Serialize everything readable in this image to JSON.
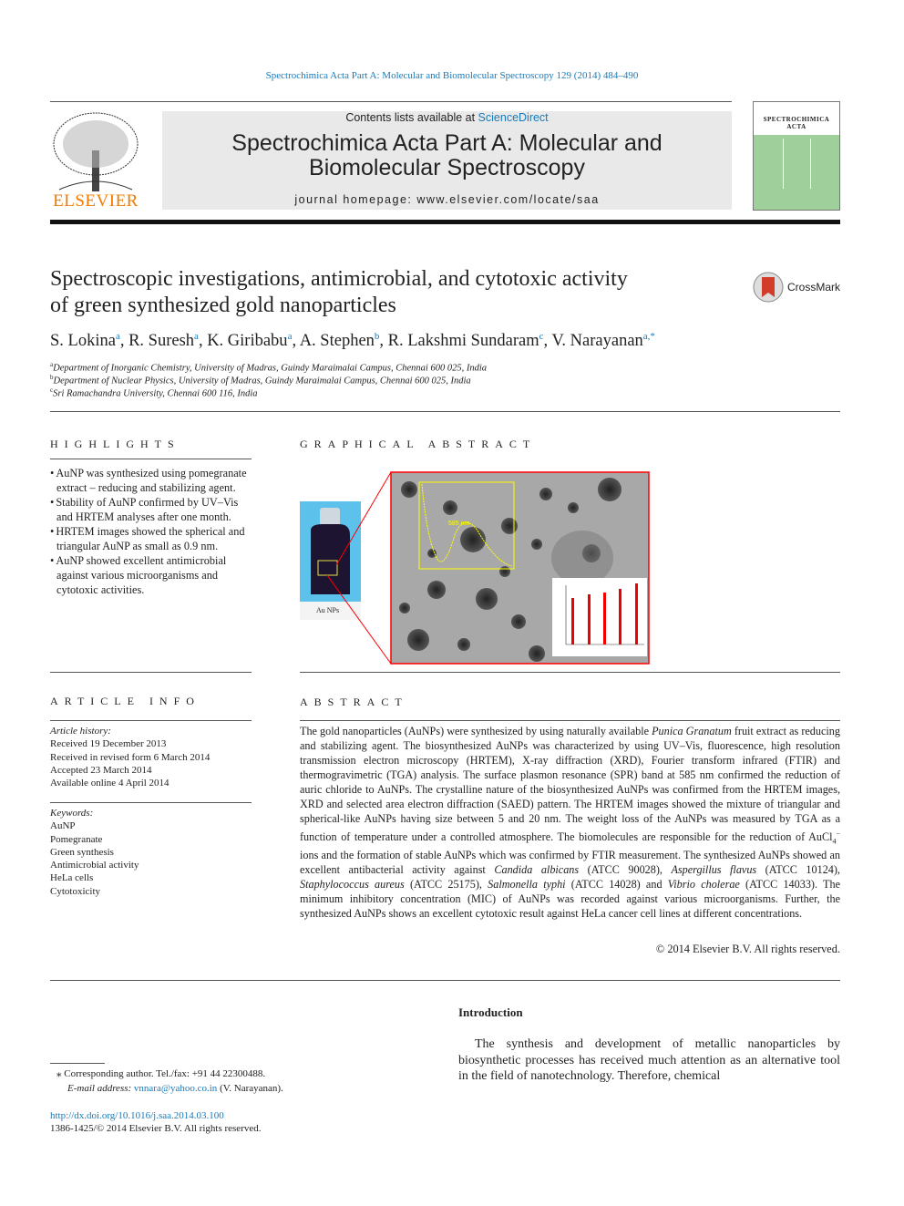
{
  "header": {
    "citation": "Spectrochimica Acta Part A: Molecular and Biomolecular Spectroscopy 129 (2014) 484–490",
    "contents_prefix": "Contents lists available at ",
    "contents_link": "ScienceDirect",
    "journal_title_1": "Spectrochimica Acta Part A: Molecular and",
    "journal_title_2": "Biomolecular Spectroscopy",
    "homepage": "journal homepage: www.elsevier.com/locate/saa",
    "publisher": "ELSEVIER",
    "cover_title": "SPECTROCHIMICA ACTA"
  },
  "article": {
    "title_1": "Spectroscopic investigations, antimicrobial, and cytotoxic activity",
    "title_2": "of green synthesized gold nanoparticles",
    "crossmark": "CrossMark",
    "authors": [
      {
        "name": "S. Lokina",
        "sup": "a"
      },
      {
        "name": "R. Suresh",
        "sup": "a"
      },
      {
        "name": "K. Giribabu",
        "sup": "a"
      },
      {
        "name": "A. Stephen",
        "sup": "b"
      },
      {
        "name": "R. Lakshmi Sundaram",
        "sup": "c"
      },
      {
        "name": "V. Narayanan",
        "sup": "a,*"
      }
    ],
    "affiliations": [
      {
        "sup": "a",
        "text": "Department of Inorganic Chemistry, University of Madras, Guindy Maraimalai Campus, Chennai 600 025, India"
      },
      {
        "sup": "b",
        "text": "Department of Nuclear Physics, University of Madras, Guindy Maraimalai Campus, Chennai 600 025, India"
      },
      {
        "sup": "c",
        "text": "Sri Ramachandra University, Chennai 600 116, India"
      }
    ]
  },
  "highlights": {
    "heading": "HIGHLIGHTS",
    "items": [
      "AuNP was synthesized using pomegranate extract – reducing and stabilizing agent.",
      "Stability of AuNP confirmed by UV–Vis and HRTEM analyses after one month.",
      "HRTEM images showed the spherical and triangular AuNP as small as 0.9 nm.",
      "AuNP showed excellent antimicrobial against various microorganisms and cytotoxic activities."
    ]
  },
  "graphical_abstract": {
    "heading": "GRAPHICAL ABSTRACT",
    "vial_label": "Au NPs",
    "peak_label": "585 nm"
  },
  "article_info": {
    "heading": "ARTICLE INFO",
    "history_label": "Article history:",
    "history": [
      "Received 19 December 2013",
      "Received in revised form 6 March 2014",
      "Accepted 23 March 2014",
      "Available online 4 April 2014"
    ],
    "keywords_label": "Keywords:",
    "keywords": [
      "AuNP",
      "Pomegranate",
      "Green synthesis",
      "Antimicrobial activity",
      "HeLa cells",
      "Cytotoxicity"
    ]
  },
  "abstract": {
    "heading": "ABSTRACT",
    "text": "The gold nanoparticles (AuNPs) were synthesized by using naturally available Punica Granatum fruit extract as reducing and stabilizing agent. The biosynthesized AuNPs was characterized by using UV–Vis, fluorescence, high resolution transmission electron microscopy (HRTEM), X-ray diffraction (XRD), Fourier transform infrared (FTIR) and thermogravimetric (TGA) analysis. The surface plasmon resonance (SPR) band at 585 nm confirmed the reduction of auric chloride to AuNPs. The crystalline nature of the biosynthesized AuNPs was confirmed from the HRTEM images, XRD and selected area electron diffraction (SAED) pattern. The HRTEM images showed the mixture of triangular and spherical-like AuNPs having size between 5 and 20 nm. The weight loss of the AuNPs was measured by TGA as a function of temperature under a controlled atmosphere. The biomolecules are responsible for the reduction of AuCl4− ions and the formation of stable AuNPs which was confirmed by FTIR measurement. The synthesized AuNPs showed an excellent antibacterial activity against Candida albicans (ATCC 90028), Aspergillus flavus (ATCC 10124), Staphylococcus aureus (ATCC 25175), Salmonella typhi (ATCC 14028) and Vibrio cholerae (ATCC 14033). The minimum inhibitory concentration (MIC) of AuNPs was recorded against various microorganisms. Further, the synthesized AuNPs shows an excellent cytotoxic result against HeLa cancer cell lines at different concentrations.",
    "copyright": "© 2014 Elsevier B.V. All rights reserved."
  },
  "introduction": {
    "heading": "Introduction",
    "text": "The synthesis and development of metallic nanoparticles by biosynthetic processes has received much attention as an alternative tool in the field of nanotechnology. Therefore, chemical"
  },
  "footnote": {
    "corresponding": "⁎ Corresponding author. Tel./fax: +91 44 22300488.",
    "email_label": "E-mail address:",
    "email": "vnnara@yahoo.co.in",
    "email_suffix": " (V. Narayanan).",
    "doi": "http://dx.doi.org/10.1016/j.saa.2014.03.100",
    "issn": "1386-1425/© 2014 Elsevier B.V. All rights reserved."
  },
  "colors": {
    "link": "#1a7ab8",
    "elsevier_orange": "#f07c00",
    "cover_green": "#9fcf9b"
  }
}
